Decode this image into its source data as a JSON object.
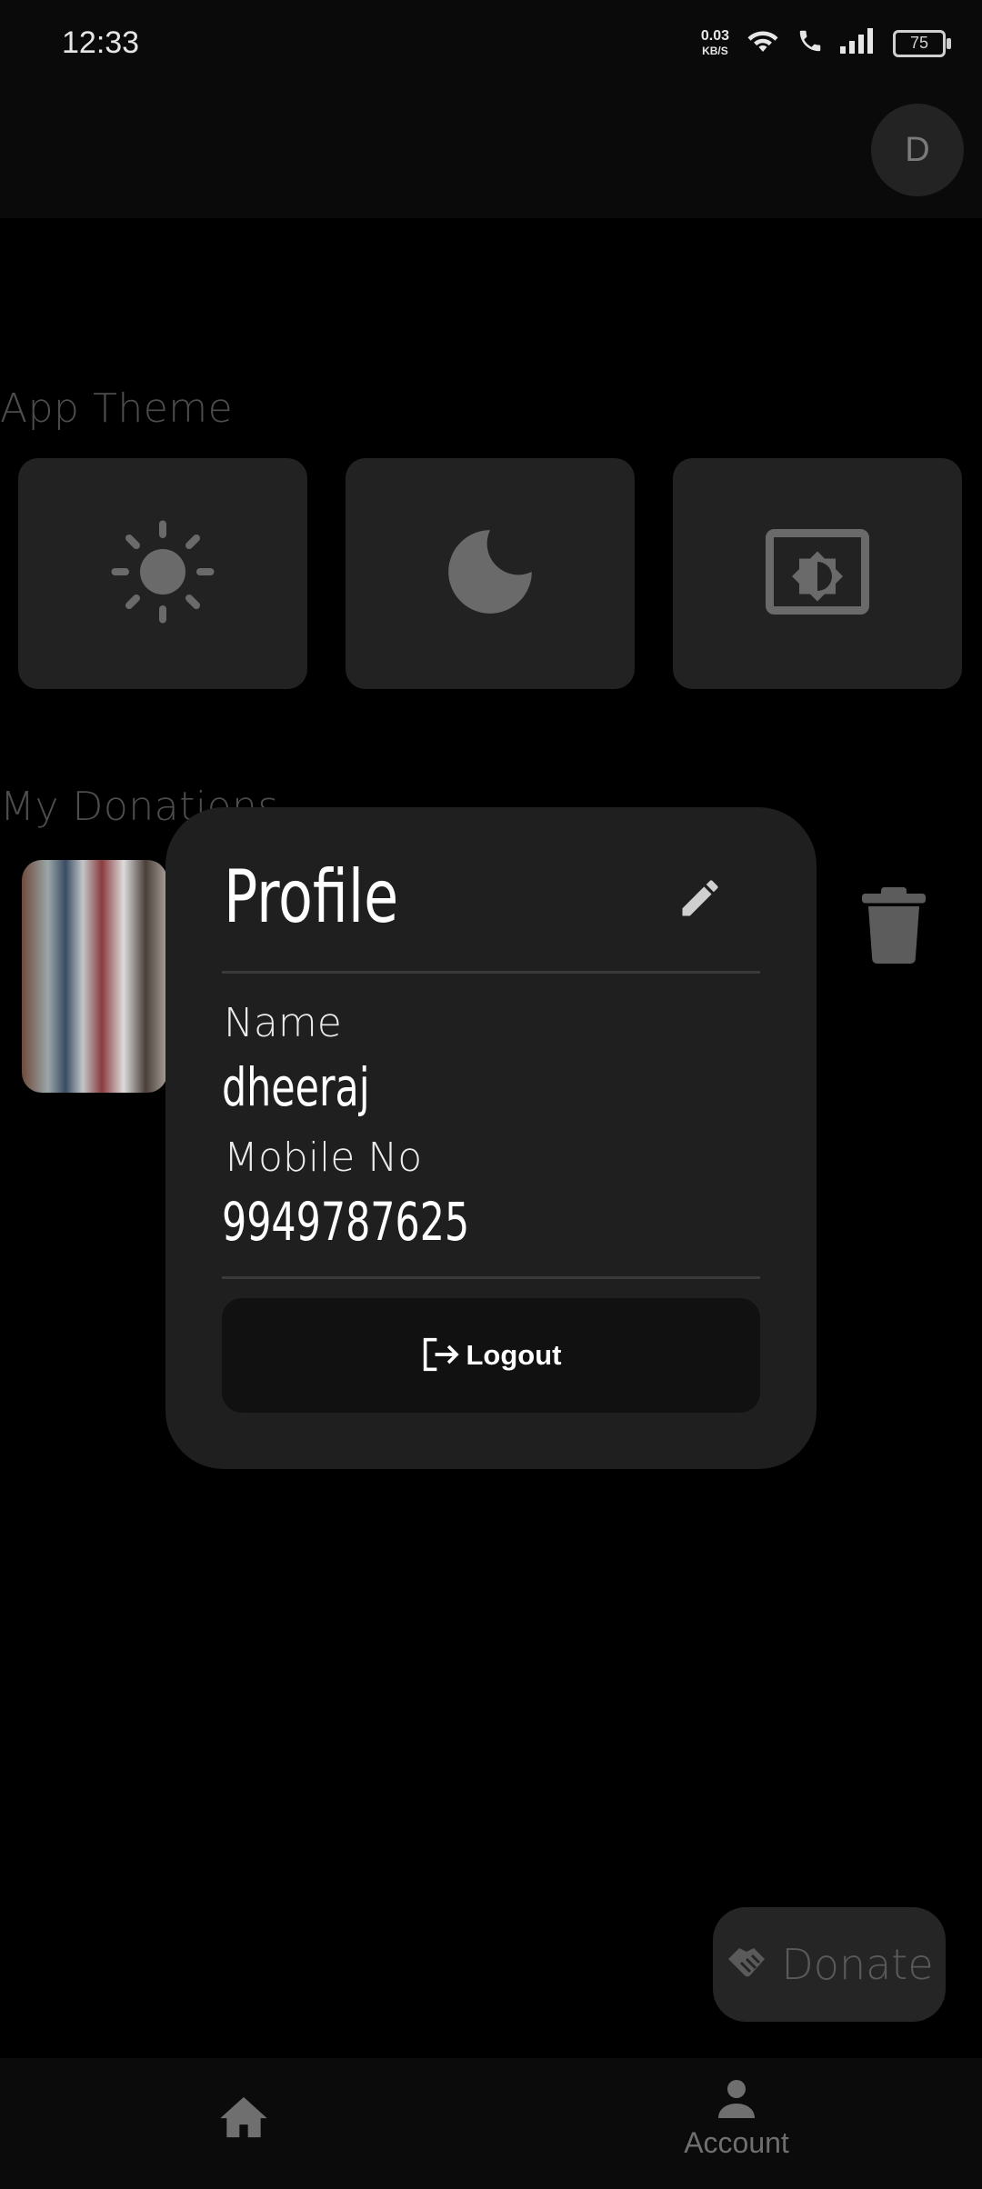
{
  "status_bar": {
    "time": "12:33",
    "net_speed_value": "0.03",
    "net_speed_unit": "KB/S",
    "battery": "75"
  },
  "app_bar": {
    "avatar_initial": "D"
  },
  "theme_section": {
    "title": "App Theme",
    "options": [
      "light-mode-icon",
      "dark-mode-icon",
      "system-theme-icon"
    ]
  },
  "donations_section": {
    "title": "My Donations"
  },
  "profile_dialog": {
    "title": "Profile",
    "name_label": "Name",
    "name_value": "dheeraj",
    "mobile_label": "Mobile No",
    "mobile_value": "9949787625",
    "logout_label": "Logout"
  },
  "fab": {
    "label": "Donate"
  },
  "bottom_nav": {
    "account_label": "Account"
  },
  "colors": {
    "background": "#000000",
    "surface": "#1f1f1f",
    "tile": "#222222",
    "muted_text": "#4d4d4d"
  }
}
